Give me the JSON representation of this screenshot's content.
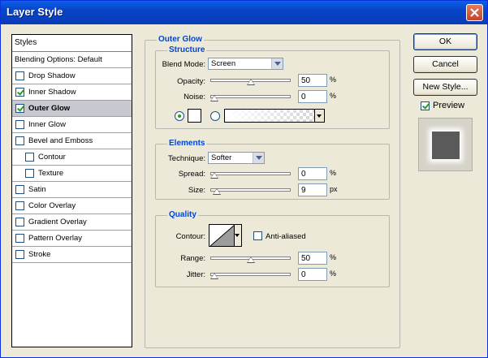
{
  "window": {
    "title": "Layer Style"
  },
  "styles_panel": {
    "header": "Styles",
    "blending_options": "Blending Options: Default",
    "items": [
      {
        "label": "Drop Shadow",
        "checked": false,
        "sub": false,
        "selected": false
      },
      {
        "label": "Inner Shadow",
        "checked": true,
        "sub": false,
        "selected": false
      },
      {
        "label": "Outer Glow",
        "checked": true,
        "sub": false,
        "selected": true
      },
      {
        "label": "Inner Glow",
        "checked": false,
        "sub": false,
        "selected": false
      },
      {
        "label": "Bevel and Emboss",
        "checked": false,
        "sub": false,
        "selected": false
      },
      {
        "label": "Contour",
        "checked": false,
        "sub": true,
        "selected": false
      },
      {
        "label": "Texture",
        "checked": false,
        "sub": true,
        "selected": false
      },
      {
        "label": "Satin",
        "checked": false,
        "sub": false,
        "selected": false
      },
      {
        "label": "Color Overlay",
        "checked": false,
        "sub": false,
        "selected": false
      },
      {
        "label": "Gradient Overlay",
        "checked": false,
        "sub": false,
        "selected": false
      },
      {
        "label": "Pattern Overlay",
        "checked": false,
        "sub": false,
        "selected": false
      },
      {
        "label": "Stroke",
        "checked": false,
        "sub": false,
        "selected": false
      }
    ]
  },
  "outer_glow": {
    "title": "Outer Glow",
    "structure": {
      "title": "Structure",
      "blend_mode_label": "Blend Mode:",
      "blend_mode_value": "Screen",
      "opacity_label": "Opacity:",
      "opacity_value": "50",
      "opacity_unit": "%",
      "opacity_fraction": 0.5,
      "noise_label": "Noise:",
      "noise_value": "0",
      "noise_unit": "%",
      "noise_fraction": 0,
      "glow_color": "#ffffff"
    },
    "elements": {
      "title": "Elements",
      "technique_label": "Technique:",
      "technique_value": "Softer",
      "spread_label": "Spread:",
      "spread_value": "0",
      "spread_unit": "%",
      "spread_fraction": 0,
      "size_label": "Size:",
      "size_value": "9",
      "size_unit": "px",
      "size_fraction": 0.036
    },
    "quality": {
      "title": "Quality",
      "contour_label": "Contour:",
      "anti_aliased_label": "Anti-aliased",
      "anti_aliased_checked": false,
      "range_label": "Range:",
      "range_value": "50",
      "range_unit": "%",
      "range_fraction": 0.5,
      "jitter_label": "Jitter:",
      "jitter_value": "0",
      "jitter_unit": "%",
      "jitter_fraction": 0
    }
  },
  "buttons": {
    "ok": "OK",
    "cancel": "Cancel",
    "new_style": "New Style...",
    "preview_label": "Preview",
    "preview_checked": true
  }
}
